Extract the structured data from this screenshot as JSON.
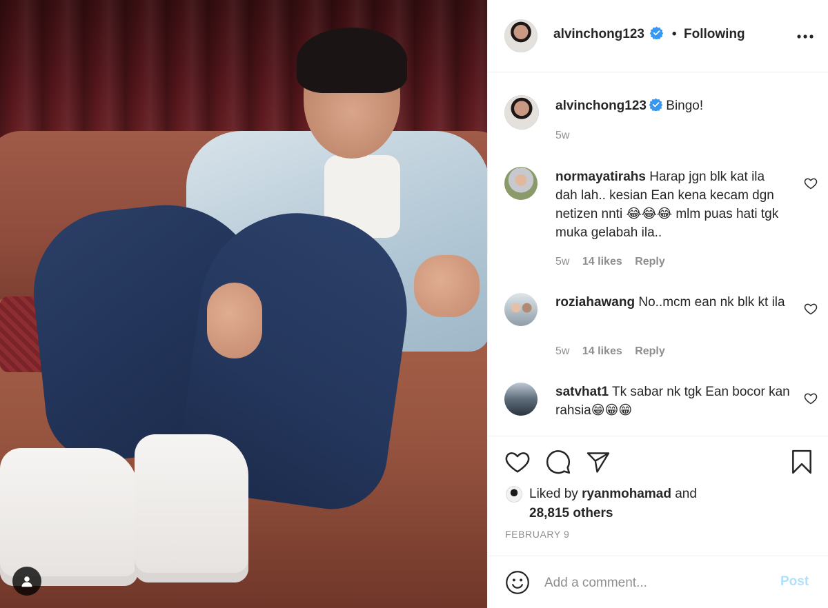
{
  "post": {
    "username": "alvinchong123",
    "follow_status": "Following",
    "separator": "•"
  },
  "caption": {
    "username": "alvinchong123",
    "text": "Bingo!",
    "time": "5w"
  },
  "comments": [
    {
      "username": "normayatirahs",
      "text": "Harap jgn blk kat ila dah lah.. kesian Ean kena kecam dgn netizen nnti 😂😂😂 mlm puas hati tgk muka gelabah ila..",
      "time": "5w",
      "likes": "14 likes",
      "reply": "Reply"
    },
    {
      "username": "roziahawang",
      "text": "No..mcm ean nk blk kt ila",
      "time": "5w",
      "likes": "14 likes",
      "reply": "Reply"
    },
    {
      "username": "satvhat1",
      "text": "Tk sabar nk tgk Ean bocor kan rahsia😁😁😁"
    }
  ],
  "likes": {
    "prefix": "Liked by",
    "user": "ryanmohamad",
    "conj": "and",
    "others": "28,815 others"
  },
  "date": "FEBRUARY 9",
  "comment_box": {
    "placeholder": "Add a comment...",
    "post_label": "Post"
  },
  "icons": {
    "more": "more-options-icon",
    "verified": "verified-badge-icon",
    "like": "heart-icon",
    "comment": "comment-bubble-icon",
    "share": "paper-plane-icon",
    "save": "bookmark-icon",
    "emoji": "smiley-icon",
    "user_tag": "person-icon"
  },
  "colors": {
    "verified": "#3897f0",
    "post_button_disabled": "#b2dffc",
    "secondary_text": "#8e8e8e",
    "border": "#efefef"
  }
}
